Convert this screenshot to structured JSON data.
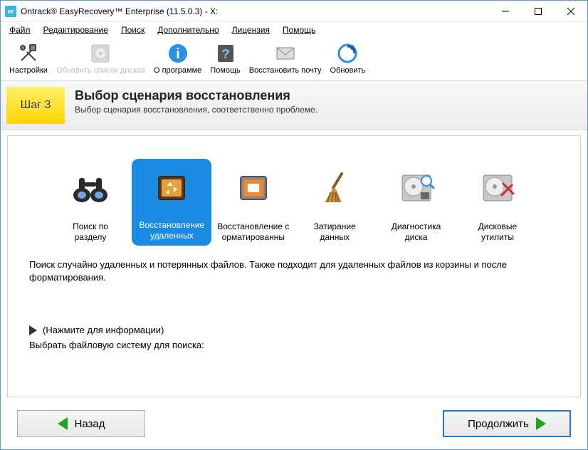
{
  "window": {
    "title": "Ontrack® EasyRecovery™ Enterprise (11.5.0.3) - X:",
    "app_icon_text": "er"
  },
  "menu": {
    "file": "Файл",
    "edit": "Редактирование",
    "search": "Поиск",
    "extra": "Дополнительно",
    "license": "Лицензия",
    "help": "Помощь"
  },
  "toolbar": {
    "settings": "Настройки",
    "refresh_disks": "Обновить список дисков",
    "about": "О программе",
    "help": "Помощь",
    "restore_mail": "Восстановить почту",
    "update": "Обновить"
  },
  "step": {
    "badge": "Шаг 3",
    "title": "Выбор сценария восстановления",
    "subtitle": "Выбор сценария восстановления, соответственно проблеме."
  },
  "options": [
    {
      "label": "Поиск по\nразделу"
    },
    {
      "label": "Восстановление удаленных"
    },
    {
      "label": "Восстановление с орматированны"
    },
    {
      "label": "Затирание\nданных"
    },
    {
      "label": "Диагностика\nдиска"
    },
    {
      "label": "Дисковые\nутилиты"
    }
  ],
  "description": "Поиск случайно удаленных и потерянных файлов. Также подходит для удаленных файлов из корзины и после форматирования.",
  "info_hint": "(Нажмите для информации)",
  "fs_label": "Выбрать файловую систему для поиска:",
  "nav": {
    "back": "Назад",
    "next": "Продолжить"
  }
}
